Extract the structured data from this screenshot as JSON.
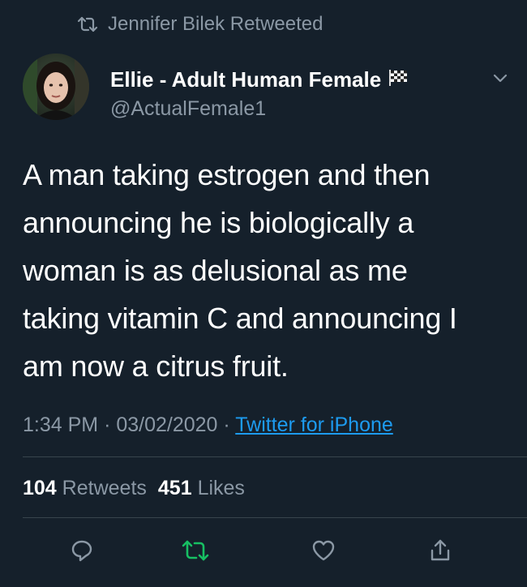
{
  "retweet_banner": {
    "icon": "retweet-icon",
    "text": "Jennifer Bilek Retweeted"
  },
  "tweet": {
    "author": {
      "display_name": "Ellie - Adult Human Female",
      "handle": "@ActualFemale1",
      "avatar": "avatar-photo",
      "badge_icon": "checkered-flag-icon"
    },
    "text": "A man taking estrogen and then\nannouncing he is biologically a\nwoman is as delusional as me\ntaking vitamin C and announcing I\nam now a citrus fruit.",
    "time": "1:34 PM",
    "separator": "·",
    "date": "03/02/2020",
    "source": "Twitter for iPhone",
    "stats": {
      "retweets_count": "104",
      "retweets_label": "Retweets",
      "likes_count": "451",
      "likes_label": "Likes"
    }
  },
  "actions": [
    "reply-icon",
    "retweet-icon",
    "like-icon",
    "share-icon"
  ],
  "colors": {
    "background": "#15202b",
    "text_primary": "#ffffff",
    "text_secondary": "#8b98a5",
    "link": "#1d9bf0",
    "retweet_green": "#17bf63",
    "divider": "#38444d"
  }
}
